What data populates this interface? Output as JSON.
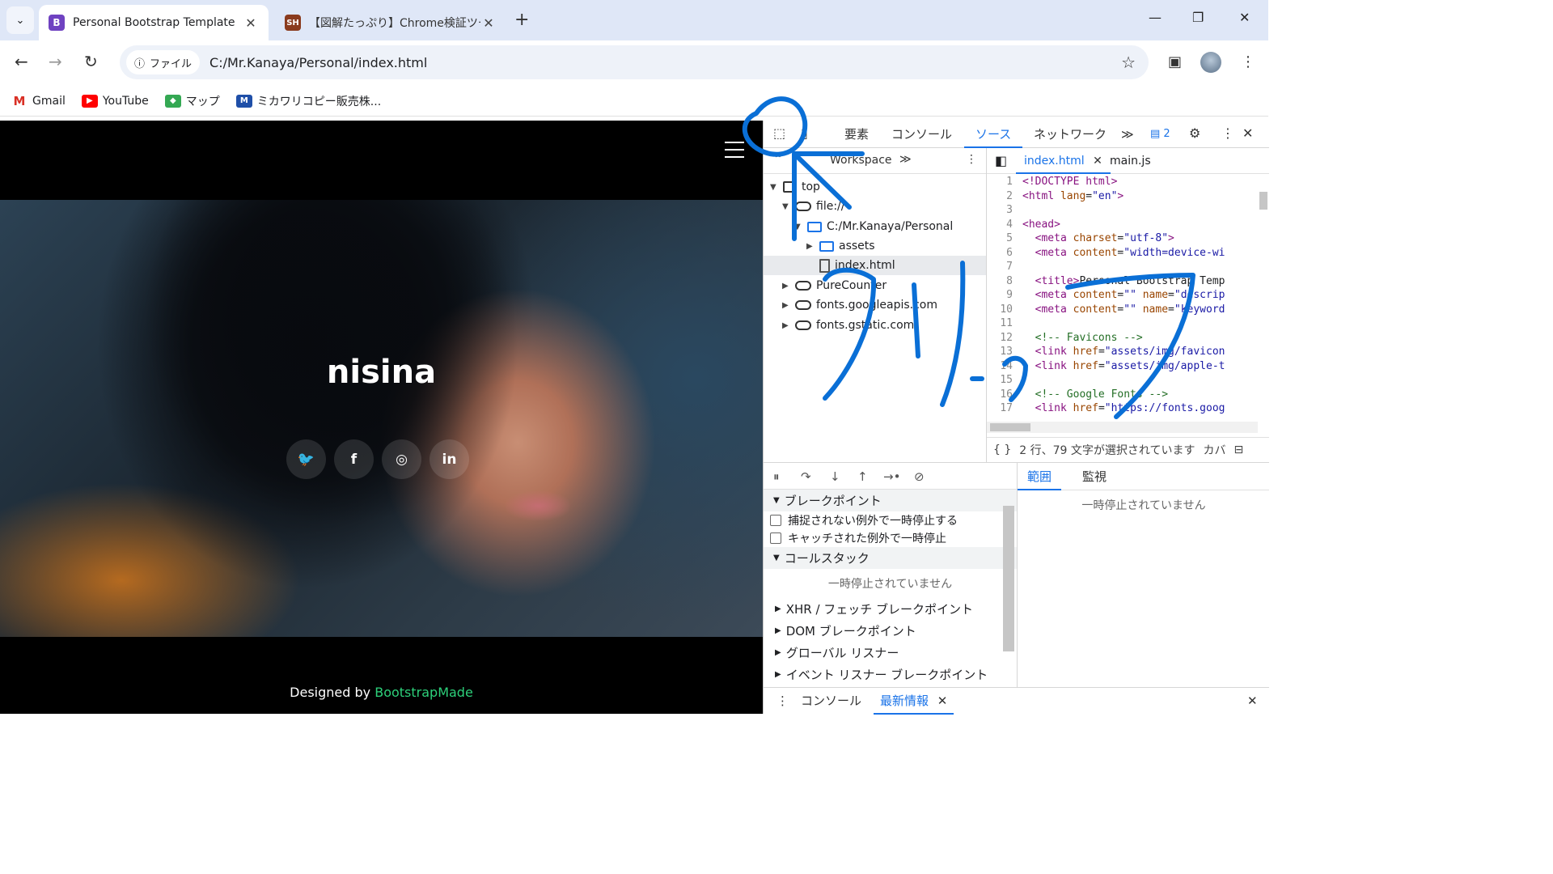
{
  "browser": {
    "tabs": [
      {
        "favicon_letter": "B",
        "favicon_color": "#6f42c1",
        "title": "Personal Bootstrap Template",
        "close": "✕"
      },
      {
        "favicon_letter": "SH",
        "favicon_color": "#8a3b1e",
        "title": "【図解たっぷり】Chrome検証ツール",
        "close": "✕"
      }
    ],
    "new_tab": "+",
    "window_controls": {
      "minimize": "—",
      "maximize": "❐",
      "close": "✕"
    },
    "nav": {
      "back": "←",
      "forward": "→",
      "reload": "↻"
    },
    "omnibox": {
      "chip_icon": "ⓘ",
      "chip_label": "ファイル",
      "url": "C:/Mr.Kanaya/Personal/index.html",
      "star": "☆"
    },
    "bookmarks": [
      {
        "label": "Gmail",
        "icon": "M",
        "color": "#d93025"
      },
      {
        "label": "YouTube",
        "icon": "▶",
        "color": "#ff0000"
      },
      {
        "label": "マップ",
        "icon": "◆",
        "color": "#34a853"
      },
      {
        "label": "ミカワリコピー販売株...",
        "icon": "M",
        "color": "#1f4fa8"
      }
    ]
  },
  "site": {
    "hero_title": "nisina",
    "socials": [
      {
        "name": "twitter",
        "glyph": "🐦"
      },
      {
        "name": "facebook",
        "glyph": "f"
      },
      {
        "name": "instagram",
        "glyph": "◎"
      },
      {
        "name": "linkedin",
        "glyph": "in"
      }
    ],
    "credit_prefix": "Designed by ",
    "credit_link": "BootstrapMade"
  },
  "devtools": {
    "top_tabs": [
      "要素",
      "コンソール",
      "ソース",
      "ネットワーク"
    ],
    "selected_tab": "ソース",
    "more": "≫",
    "issues_badge": "▤ 2",
    "navigator": {
      "head_label": "Workspace",
      "tree": [
        {
          "label": "top",
          "indent": 0,
          "icon": "frame"
        },
        {
          "label": "file://",
          "indent": 1,
          "icon": "cloud"
        },
        {
          "label": "C:/Mr.Kanaya/Personal",
          "indent": 2,
          "icon": "folder"
        },
        {
          "label": "assets",
          "indent": 3,
          "icon": "folder"
        },
        {
          "label": "index.html",
          "indent": 3,
          "icon": "file"
        },
        {
          "label": "PureCounter",
          "indent": 1,
          "icon": "cloud"
        },
        {
          "label": "fonts.googleapis.com",
          "indent": 1,
          "icon": "cloud"
        },
        {
          "label": "fonts.gstatic.com",
          "indent": 1,
          "icon": "cloud"
        }
      ]
    },
    "editor": {
      "tabs": [
        {
          "label": "index.html",
          "close": "✕"
        },
        {
          "label": "main.js"
        }
      ],
      "lines": [
        {
          "n": "1",
          "html": "<span class='tag'>&lt;!DOCTYPE html&gt;</span>"
        },
        {
          "n": "2",
          "html": "<span class='tag'>&lt;html </span><span class='attr'>lang</span>=<span class='val'>\"en\"</span><span class='tag'>&gt;</span>"
        },
        {
          "n": "3",
          "html": ""
        },
        {
          "n": "4",
          "html": "<span class='tag'>&lt;head&gt;</span>"
        },
        {
          "n": "5",
          "html": "  <span class='tag'>&lt;meta </span><span class='attr'>charset</span>=<span class='val'>\"utf-8\"</span><span class='tag'>&gt;</span>"
        },
        {
          "n": "6",
          "html": "  <span class='tag'>&lt;meta </span><span class='attr'>content</span>=<span class='val'>\"width=device-wi</span>"
        },
        {
          "n": "7",
          "html": ""
        },
        {
          "n": "8",
          "html": "  <span class='tag'>&lt;title&gt;</span>Personal Bootstrap Temp"
        },
        {
          "n": "9",
          "html": "  <span class='tag'>&lt;meta </span><span class='attr'>content</span>=<span class='val'>\"\"</span> <span class='attr'>name</span>=<span class='val'>\"descrip</span>"
        },
        {
          "n": "10",
          "html": "  <span class='tag'>&lt;meta </span><span class='attr'>content</span>=<span class='val'>\"\"</span> <span class='attr'>name</span>=<span class='val'>\"keyword</span>"
        },
        {
          "n": "11",
          "html": ""
        },
        {
          "n": "12",
          "html": "  <span class='cmt'>&lt;!-- Favicons --&gt;</span>"
        },
        {
          "n": "13",
          "html": "  <span class='tag'>&lt;link </span><span class='attr'>href</span>=<span class='val'>\"assets/img/favicon</span>"
        },
        {
          "n": "14",
          "html": "  <span class='tag'>&lt;link </span><span class='attr'>href</span>=<span class='val'>\"assets/img/apple-t</span>"
        },
        {
          "n": "15",
          "html": ""
        },
        {
          "n": "16",
          "html": "  <span class='cmt'>&lt;!-- Google Fonts --&gt;</span>"
        },
        {
          "n": "17",
          "html": "  <span class='tag'>&lt;link </span><span class='attr'>href</span>=<span class='val'>\"https://fonts.goog</span>"
        }
      ],
      "status_braces": "{ }",
      "status_text": "2 行、79 文字が選択されています",
      "status_coverage": "カバ"
    },
    "debugger": {
      "breakpoints_title": "ブレークポイント",
      "pause_uncaught": "捕捉されない例外で一時停止する",
      "pause_caught": "キャッチされた例外で一時停止",
      "callstack_title": "コールスタック",
      "not_paused": "一時停止されていません",
      "xhr": "XHR / フェッチ ブレークポイント",
      "dom": "DOM ブレークポイント",
      "global": "グローバル リスナー",
      "event": "イベント リスナー ブレークポイント"
    },
    "scope": {
      "tab_scope": "範囲",
      "tab_watch": "監視",
      "note": "一時停止されていません"
    },
    "drawer": {
      "dots": "⋮",
      "console": "コンソール",
      "whats_new": "最新情報",
      "close": "✕"
    }
  },
  "annotation": {
    "text": "クリック",
    "color": "#0a6fd6"
  }
}
